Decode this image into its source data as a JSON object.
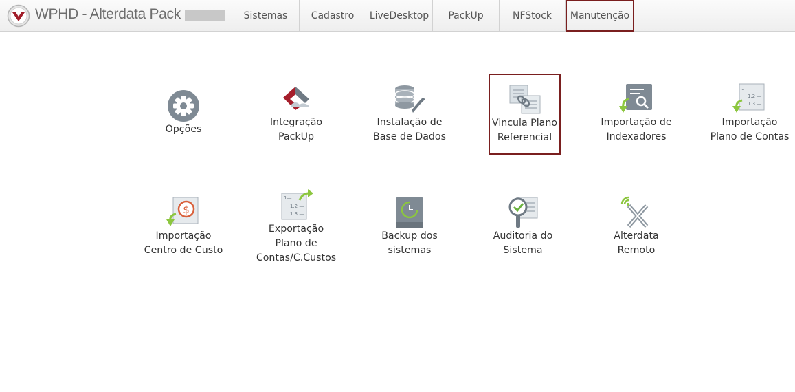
{
  "app": {
    "title": "WPHD - Alterdata Pack"
  },
  "accent_color": "#7a1f1f",
  "menu": {
    "tabs": [
      {
        "label": "Sistemas"
      },
      {
        "label": "Cadastro"
      },
      {
        "label": "LiveDesktop"
      },
      {
        "label": "PackUp"
      },
      {
        "label": "NFStock"
      },
      {
        "label": "Manutenção",
        "selected": true
      }
    ]
  },
  "tools": [
    {
      "line1": "Opções",
      "line2": "",
      "icon": "gear-icon"
    },
    {
      "line1": "Integração",
      "line2": "PackUp",
      "icon": "packup-integration-icon"
    },
    {
      "line1": "Instalação de",
      "line2": "Base de Dados",
      "icon": "database-wrench-icon"
    },
    {
      "line1": "Vincula Plano",
      "line2": "Referencial",
      "icon": "linked-documents-icon",
      "selected": true
    },
    {
      "line1": "Importação de",
      "line2": "Indexadores",
      "icon": "import-search-icon"
    },
    {
      "line1": "Importação",
      "line2": "Plano de Contas",
      "icon": "import-list-icon"
    },
    {
      "line1": "Importação",
      "line2": "Centro de Custo",
      "icon": "import-cost-center-icon"
    },
    {
      "line1": "Exportação",
      "line2": "Plano de",
      "line3": "Contas/C.Custos",
      "icon": "export-list-icon"
    },
    {
      "line1": "Backup dos",
      "line2": "sistemas",
      "icon": "backup-clock-icon"
    },
    {
      "line1": "Auditoria do",
      "line2": "Sistema",
      "icon": "audit-magnifier-icon"
    },
    {
      "line1": "Alterdata",
      "line2": "Remoto",
      "icon": "remote-access-icon"
    }
  ]
}
